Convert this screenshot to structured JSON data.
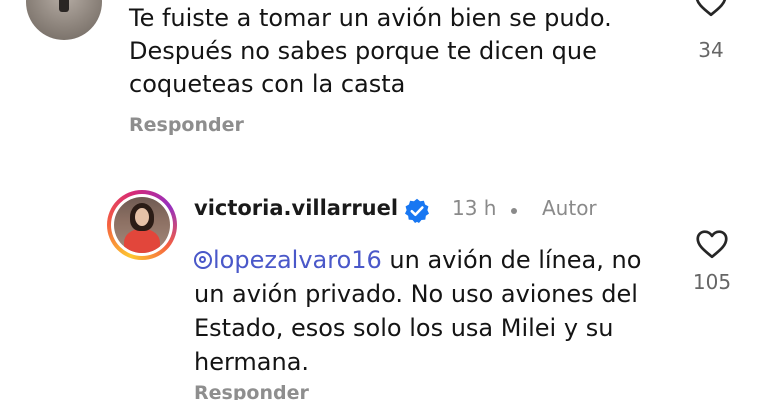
{
  "top_comment": {
    "text": "Te fuiste a tomar un avión bien se pudo. Después no sabes porque te dicen que coqueteas con la casta",
    "reply_label": "Responder",
    "like_count": "34",
    "like_icon": "heart-outline-icon"
  },
  "reply_comment": {
    "username": "victoria.villarruel",
    "verified_icon": "verified-badge-icon",
    "time": "13 h",
    "author_label": "Autor",
    "mention": "lopezalvaro16",
    "text": " un avión de línea, no un avión privado. No uso aviones del Estado, esos solo los usa Milei y su hermana.",
    "reply_label": "Responder",
    "like_count": "105",
    "like_icon": "heart-outline-icon"
  },
  "colors": {
    "mention": "#4a58c9",
    "verified": "#1877f2",
    "muted": "#8e8e8e"
  }
}
